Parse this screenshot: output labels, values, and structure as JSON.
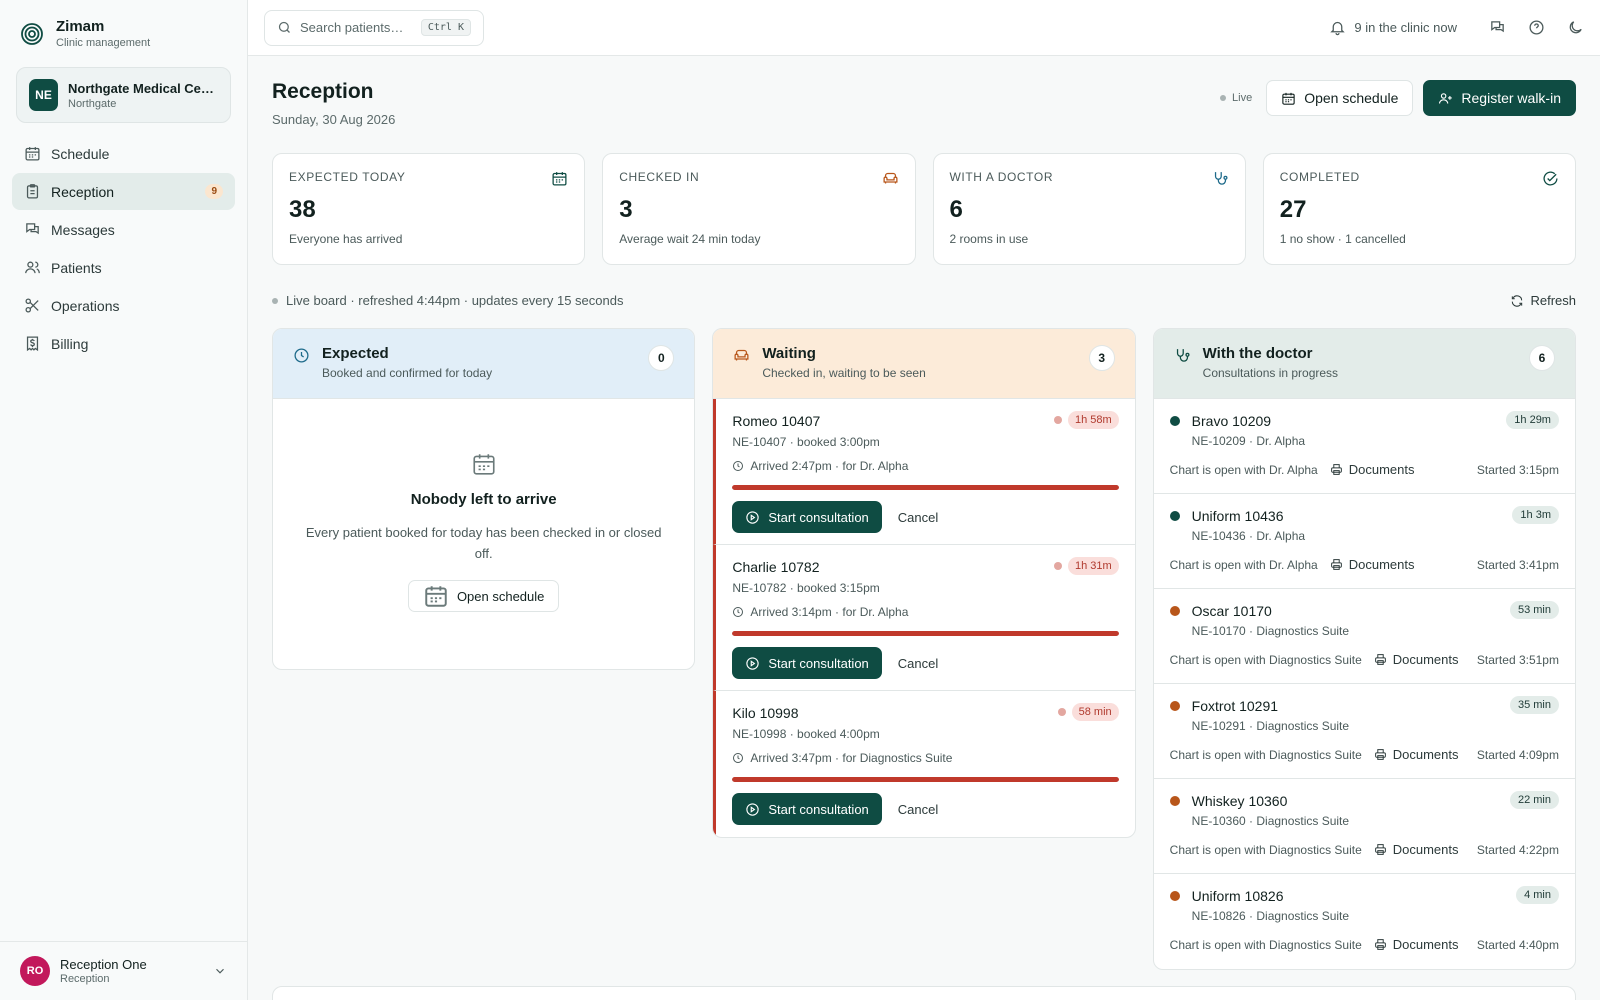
{
  "brand": {
    "name": "Zimam",
    "subtitle": "Clinic management"
  },
  "org": {
    "initials": "NE",
    "name": "Northgate Medical Centre",
    "location": "Northgate"
  },
  "nav": [
    {
      "label": "Schedule",
      "icon": "calendar-icon"
    },
    {
      "label": "Reception",
      "icon": "clipboard-icon",
      "count": "9",
      "active": true
    },
    {
      "label": "Messages",
      "icon": "messages-icon"
    },
    {
      "label": "Patients",
      "icon": "users-icon"
    },
    {
      "label": "Operations",
      "icon": "scissors-icon"
    },
    {
      "label": "Billing",
      "icon": "receipt-icon"
    }
  ],
  "user": {
    "initials": "RO",
    "name": "Reception One",
    "role": "Reception"
  },
  "topbar": {
    "search_placeholder": "Search patients…",
    "shortcut": "Ctrl K",
    "clinic_now": "9 in the clinic now"
  },
  "page": {
    "title": "Reception",
    "date": "Sunday, 30 Aug 2026",
    "live": "Live",
    "open_schedule": "Open schedule",
    "register": "Register walk-in"
  },
  "stats": [
    {
      "label": "EXPECTED TODAY",
      "value": "38",
      "note": "Everyone has arrived",
      "icon": "calendar-icon",
      "color": "#0f4c43"
    },
    {
      "label": "CHECKED IN",
      "value": "3",
      "note": "Average wait 24 min today",
      "icon": "sofa-icon",
      "color": "#b8561a"
    },
    {
      "label": "WITH A DOCTOR",
      "value": "6",
      "note": "2 rooms in use",
      "icon": "stethoscope-icon",
      "color": "#1d6a8a"
    },
    {
      "label": "COMPLETED",
      "value": "27",
      "note": "1 no show · 1 cancelled",
      "icon": "check-circle-icon",
      "color": "#0f4c43"
    }
  ],
  "board": {
    "status": "Live board · refreshed 4:44pm · updates every 15 seconds",
    "refresh": "Refresh"
  },
  "expected": {
    "title": "Expected",
    "subtitle": "Booked and confirmed for today",
    "count": "0",
    "empty_title": "Nobody left to arrive",
    "empty_desc": "Every patient booked for today has been checked in or closed off.",
    "button": "Open schedule"
  },
  "waiting": {
    "title": "Waiting",
    "subtitle": "Checked in, waiting to be seen",
    "count": "3",
    "start_label": "Start consultation",
    "cancel_label": "Cancel",
    "items": [
      {
        "name": "Romeo 10407",
        "meta": "NE-10407 · booked 3:00pm",
        "arrived": "Arrived 2:47pm · for Dr. Alpha",
        "wait": "1h 58m",
        "progress": 1.0
      },
      {
        "name": "Charlie 10782",
        "meta": "NE-10782 · booked 3:15pm",
        "arrived": "Arrived 3:14pm · for Dr. Alpha",
        "wait": "1h 31m",
        "progress": 1.0
      },
      {
        "name": "Kilo 10998",
        "meta": "NE-10998 · booked 4:00pm",
        "arrived": "Arrived 3:47pm · for Diagnostics Suite",
        "wait": "58 min",
        "progress": 1.0
      }
    ]
  },
  "doctor": {
    "title": "With the doctor",
    "subtitle": "Consultations in progress",
    "count": "6",
    "docs_label": "Documents",
    "items": [
      {
        "name": "Bravo 10209",
        "meta": "NE-10209 · Dr. Alpha",
        "chart": "Chart is open with Dr. Alpha",
        "duration": "1h 29m",
        "started": "Started 3:15pm",
        "color": "#0f4c43"
      },
      {
        "name": "Uniform 10436",
        "meta": "NE-10436 · Dr. Alpha",
        "chart": "Chart is open with Dr. Alpha",
        "duration": "1h 3m",
        "started": "Started 3:41pm",
        "color": "#0f4c43"
      },
      {
        "name": "Oscar 10170",
        "meta": "NE-10170 · Diagnostics Suite",
        "chart": "Chart is open with Diagnostics Suite",
        "duration": "53 min",
        "started": "Started 3:51pm",
        "color": "#b8561a"
      },
      {
        "name": "Foxtrot 10291",
        "meta": "NE-10291 · Diagnostics Suite",
        "chart": "Chart is open with Diagnostics Suite",
        "duration": "35 min",
        "started": "Started 4:09pm",
        "color": "#b8561a"
      },
      {
        "name": "Whiskey 10360",
        "meta": "NE-10360 · Diagnostics Suite",
        "chart": "Chart is open with Diagnostics Suite",
        "duration": "22 min",
        "started": "Started 4:22pm",
        "color": "#b8561a"
      },
      {
        "name": "Uniform 10826",
        "meta": "NE-10826 · Diagnostics Suite",
        "chart": "Chart is open with Diagnostics Suite",
        "duration": "4 min",
        "started": "Started 4:40pm",
        "color": "#b8561a"
      }
    ]
  }
}
